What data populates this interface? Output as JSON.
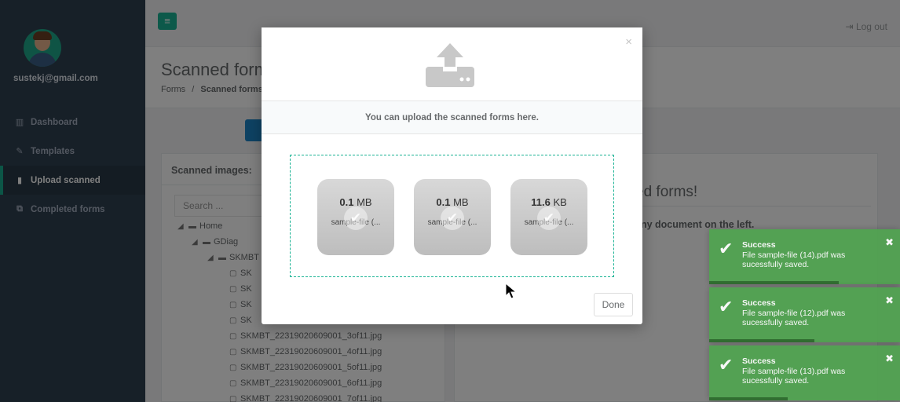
{
  "user": {
    "email": "sustekj@gmail.com"
  },
  "nav": [
    {
      "label": "Dashboard",
      "icon": "bar-chart-icon"
    },
    {
      "label": "Templates",
      "icon": "edit-icon"
    },
    {
      "label": "Upload scanned",
      "icon": "file-icon",
      "active": true
    },
    {
      "label": "Completed forms",
      "icon": "files-icon"
    }
  ],
  "topbar": {
    "logout_label": "Log out"
  },
  "page": {
    "title": "Scanned forms",
    "breadcrumb_root": "Forms",
    "breadcrumb_sep": "/",
    "breadcrumb_current": "Scanned forms"
  },
  "left_panel": {
    "title": "Scanned images:",
    "search_placeholder": "Search ...",
    "tree": [
      {
        "label": "Home",
        "level": 0,
        "type": "folder"
      },
      {
        "label": "GDiag",
        "level": 1,
        "type": "folder"
      },
      {
        "label": "SKMBT",
        "level": 2,
        "type": "folder"
      },
      {
        "label": "SK",
        "level": 3,
        "type": "file"
      },
      {
        "label": "SK",
        "level": 3,
        "type": "file"
      },
      {
        "label": "SK",
        "level": 3,
        "type": "file"
      },
      {
        "label": "SK",
        "level": 3,
        "type": "file"
      },
      {
        "label": "SKMBT_22319020609001_3of11.jpg",
        "level": 3,
        "type": "file"
      },
      {
        "label": "SKMBT_22319020609001_4of11.jpg",
        "level": 3,
        "type": "file"
      },
      {
        "label": "SKMBT_22319020609001_5of11.jpg",
        "level": 3,
        "type": "file"
      },
      {
        "label": "SKMBT_22319020609001_6of11.jpg",
        "level": 3,
        "type": "file"
      },
      {
        "label": "SKMBT_22319020609001_7of11.jpg",
        "level": 3,
        "type": "file"
      }
    ]
  },
  "right_panel": {
    "heading": "ed forms!",
    "text": "any document on the left."
  },
  "modal": {
    "close_label": "×",
    "subtitle": "You can upload the scanned forms here.",
    "done_label": "Done",
    "files": [
      {
        "size_value": "0.1",
        "size_unit": "MB",
        "name": "sample-file (..."
      },
      {
        "size_value": "0.1",
        "size_unit": "MB",
        "name": "sample-file (..."
      },
      {
        "size_value": "11.6",
        "size_unit": "KB",
        "name": "sample-file (..."
      }
    ]
  },
  "toasts": [
    {
      "title": "Success",
      "message": "File sample-file (14).pdf was sucessfully saved.",
      "progress": 0.68
    },
    {
      "title": "Success",
      "message": "File sample-file (12).pdf was sucessfully saved.",
      "progress": 0.55
    },
    {
      "title": "Success",
      "message": "File sample-file (13).pdf was sucessfully saved.",
      "progress": 0.41
    }
  ],
  "colors": {
    "sidebar": "#2f4050",
    "accent": "#1ab394",
    "primary": "#1c84c6",
    "toast_success": "#51a351"
  }
}
